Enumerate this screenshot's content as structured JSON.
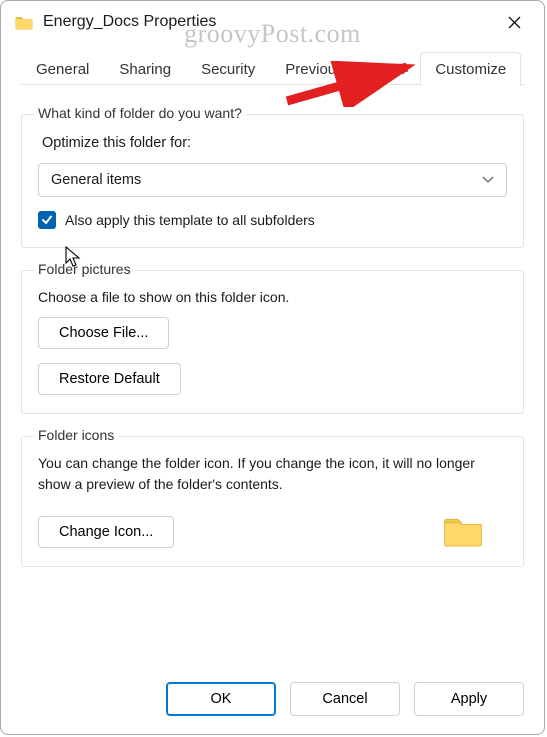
{
  "window": {
    "title": "Energy_Docs Properties"
  },
  "watermark": "groovyPost.com",
  "tabs": {
    "general": "General",
    "sharing": "Sharing",
    "security": "Security",
    "previous": "Previous Versions",
    "customize": "Customize"
  },
  "group1": {
    "legend": "What kind of folder do you want?",
    "optimizeLabel": "Optimize this folder for:",
    "dropdownValue": "General items",
    "checkboxLabel": "Also apply this template to all subfolders"
  },
  "group2": {
    "legend": "Folder pictures",
    "desc": "Choose a file to show on this folder icon.",
    "chooseFile": "Choose File...",
    "restoreDefault": "Restore Default"
  },
  "group3": {
    "legend": "Folder icons",
    "desc": "You can change the folder icon. If you change the icon, it will no longer show a preview of the folder's contents.",
    "changeIcon": "Change Icon..."
  },
  "footer": {
    "ok": "OK",
    "cancel": "Cancel",
    "apply": "Apply"
  }
}
